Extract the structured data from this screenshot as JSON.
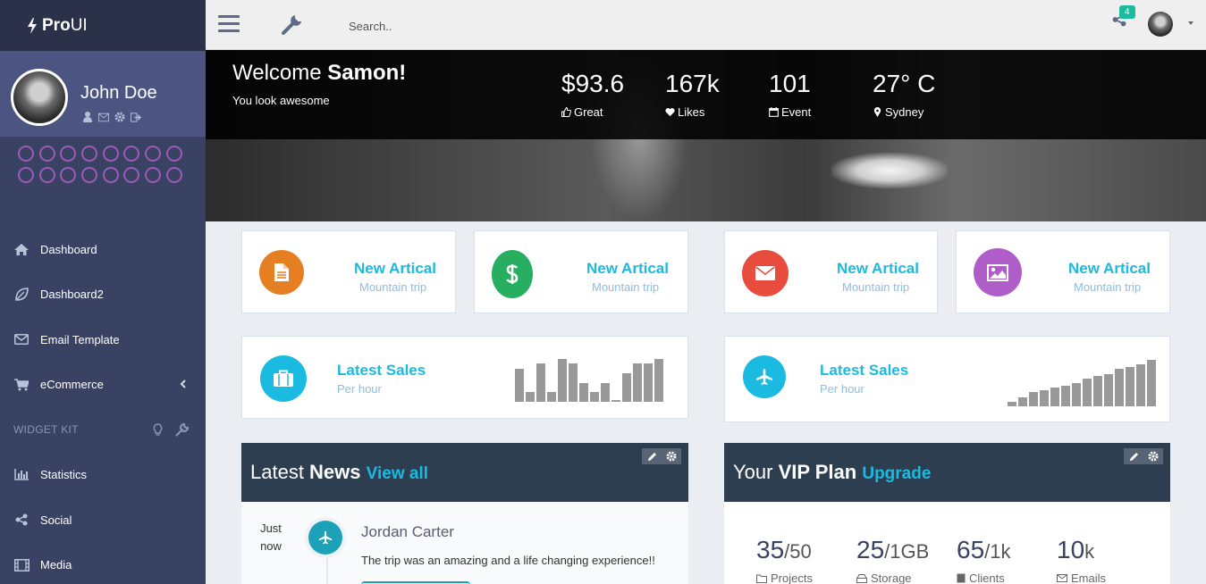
{
  "brand": {
    "name_bold": "Pro",
    "name_rest": "UI"
  },
  "user": {
    "name": "John Doe"
  },
  "nav": {
    "items": [
      {
        "label": "Dashboard",
        "icon": "home-icon"
      },
      {
        "label": "Dashboard2",
        "icon": "leaf-icon"
      },
      {
        "label": "Email Template",
        "icon": "envelope-icon"
      },
      {
        "label": "eCommerce",
        "icon": "cart-icon"
      }
    ],
    "widget_header": "WIDGET KIT",
    "widget_items": [
      {
        "label": "Statistics",
        "icon": "bar-chart-icon"
      },
      {
        "label": "Social",
        "icon": "share-icon"
      },
      {
        "label": "Media",
        "icon": "film-icon"
      }
    ]
  },
  "topbar": {
    "search_placeholder": "Search..",
    "notifications": "4"
  },
  "hero": {
    "welcome_prefix": "Welcome ",
    "welcome_name": "Samon!",
    "subtitle": "You look awesome",
    "stats": [
      {
        "value": "$93.6",
        "label": "Great",
        "icon": "thumbs-up-icon"
      },
      {
        "value": "167k",
        "label": "Likes",
        "icon": "heart-icon"
      },
      {
        "value": "101",
        "label": "Event",
        "icon": "calendar-icon"
      },
      {
        "value": "27° C",
        "label": "Sydney",
        "icon": "map-marker-icon"
      }
    ]
  },
  "widgets": [
    {
      "title": "New Artical",
      "subtitle": "Mountain trip",
      "color": "#e67e22",
      "icon": "file-icon"
    },
    {
      "title": "New Artical",
      "subtitle": "Mountain trip",
      "color": "#27ae60",
      "icon": "dollar-icon"
    },
    {
      "title": "New Artical",
      "subtitle": "Mountain trip",
      "color": "#e74c3c",
      "icon": "envelope-icon"
    },
    {
      "title": "New Artical",
      "subtitle": "Mountain trip",
      "color": "#af5ec9",
      "icon": "image-icon"
    }
  ],
  "sales": [
    {
      "title": "Latest Sales",
      "subtitle": "Per hour",
      "icon": "briefcase-icon",
      "bars": [
        7,
        2,
        8,
        2,
        9,
        8,
        4,
        2,
        4,
        0,
        6,
        8,
        8,
        9
      ]
    },
    {
      "title": "Latest Sales",
      "subtitle": "Per hour",
      "icon": "plane-icon",
      "bars": [
        1,
        2,
        3,
        3.5,
        4,
        4.5,
        5,
        6,
        6.5,
        7,
        8,
        8.5,
        9,
        10
      ]
    }
  ],
  "news": {
    "title_prefix": "Latest ",
    "title_bold": "News",
    "link": "View all",
    "item": {
      "time_line1": "Just",
      "time_line2": "now",
      "name": "Jordan Carter",
      "text": "The trip was an amazing and a life changing experience!!"
    }
  },
  "vip": {
    "title_prefix": "Your ",
    "title_bold": "VIP Plan",
    "link": "Upgrade",
    "stats": [
      {
        "value": "35",
        "unit": "/50",
        "label": "Projects"
      },
      {
        "value": "25",
        "unit": "/1GB",
        "label": "Storage"
      },
      {
        "value": "65",
        "unit": "/1k",
        "label": "Clients"
      },
      {
        "value": "10",
        "unit": "k",
        "label": "Emails"
      }
    ]
  },
  "colors": {
    "sidebar": "#394263",
    "accent": "#1bbae1",
    "panel_header": "#2c3e50"
  }
}
